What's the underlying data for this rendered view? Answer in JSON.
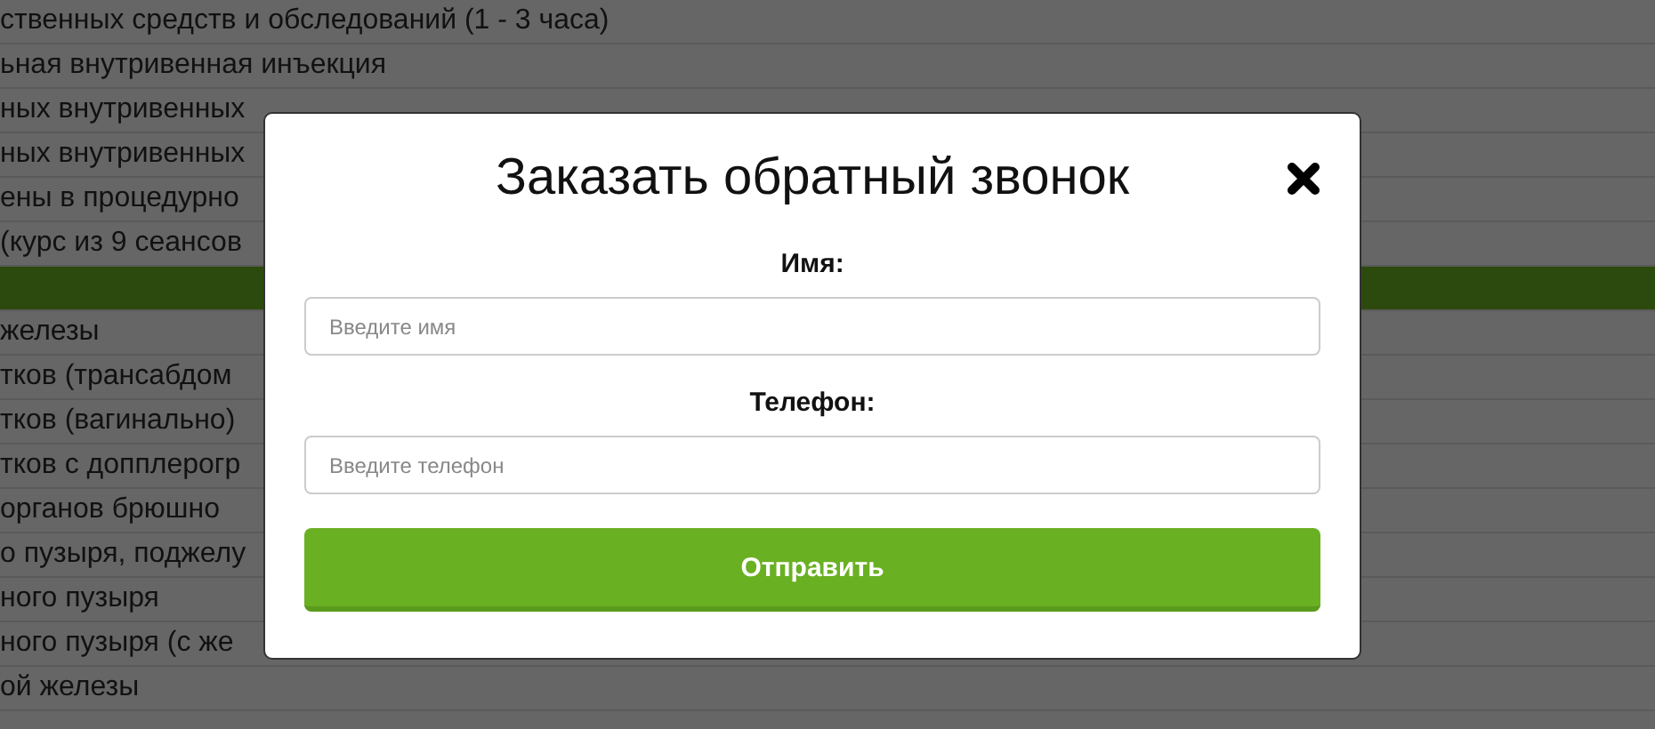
{
  "background_list": {
    "rows": [
      {
        "text": "ственных средств и обследований (1 - 3 часа)",
        "highlighted": false
      },
      {
        "text": "ьная внутривенная инъекция",
        "highlighted": false
      },
      {
        "text": "ных внутривенных",
        "highlighted": false
      },
      {
        "text": "ных внутривенных",
        "highlighted": false
      },
      {
        "text": "ены в процедурно",
        "highlighted": false
      },
      {
        "text": "(курс из 9 сеансов",
        "highlighted": false
      },
      {
        "text": "",
        "highlighted": true
      },
      {
        "text": "железы",
        "highlighted": false
      },
      {
        "text": "тков (трансабдом",
        "highlighted": false
      },
      {
        "text": "тков (вагинально)",
        "highlighted": false
      },
      {
        "text": "тков с допплерогр",
        "highlighted": false
      },
      {
        "text": "органов брюшно",
        "highlighted": false
      },
      {
        "text": "о пузыря, поджелу",
        "highlighted": false
      },
      {
        "text": "ного пузыря",
        "highlighted": false
      },
      {
        "text": "ного пузыря (с же",
        "highlighted": false
      },
      {
        "text": "ой железы",
        "highlighted": false
      }
    ]
  },
  "modal": {
    "title": "Заказать обратный звонок",
    "fields": [
      {
        "label": "Имя:",
        "placeholder": "Введите имя"
      },
      {
        "label": "Телефон:",
        "placeholder": "Введите телефон"
      }
    ],
    "submit_button": "Отправить"
  }
}
